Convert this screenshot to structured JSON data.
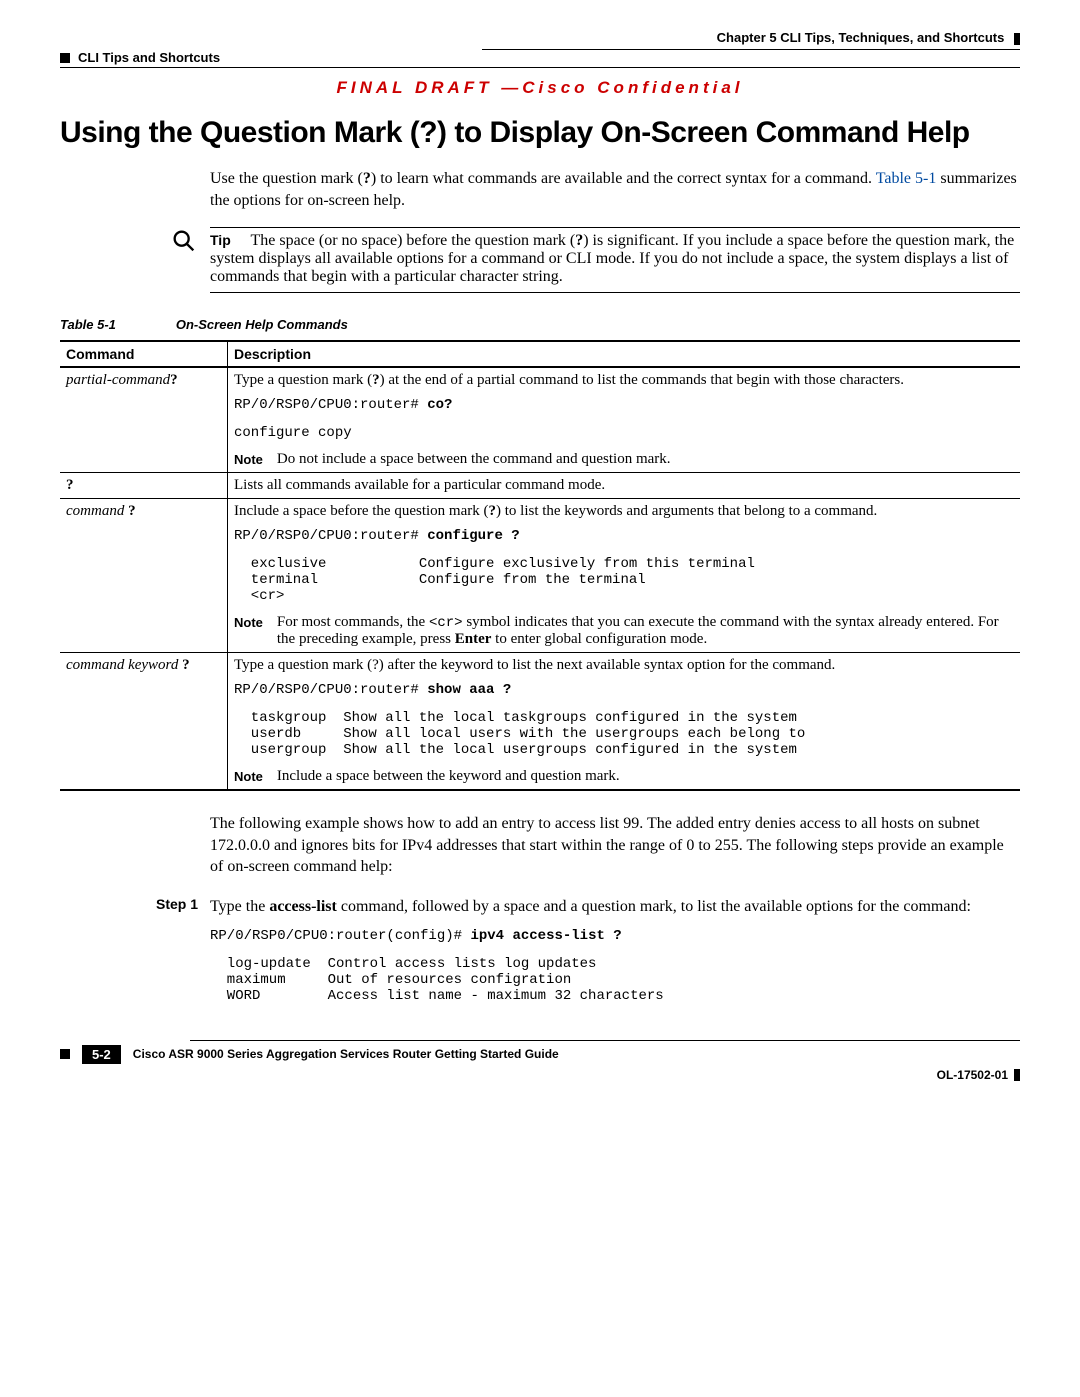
{
  "header": {
    "chapter": "Chapter 5    CLI Tips, Techniques, and Shortcuts",
    "section": "CLI Tips and Shortcuts"
  },
  "banner": "FINAL DRAFT —Cisco Confidential",
  "title": "Using the Question Mark (?) to Display On-Screen Command Help",
  "intro": {
    "line1a": "Use the question mark (",
    "line1b": ") to learn what commands are available and the correct syntax for a command. ",
    "table_ref": "Table 5-1",
    "line2": " summarizes the options for on-screen help."
  },
  "tip": {
    "label": "Tip",
    "text_a": "The space (or no space) before the question mark (",
    "text_b": ") is significant. If you include a space before the question mark, the system displays all available options for a command or CLI mode. If you do not include a space, the system displays a list of commands that begin with a particular character string."
  },
  "table": {
    "caption_num": "Table 5-1",
    "caption_title": "On-Screen Help Commands",
    "head_cmd": "Command",
    "head_desc": "Description",
    "rows": [
      {
        "cmd_html": "partial-command<span style='font-style:normal;font-weight:bold'>?</span>",
        "desc": "Type a question mark (<b>?</b>) at the end of a partial command to list the commands that begin with those characters.",
        "code_prompt": "RP/0/RSP0/CPU0:router# ",
        "code_bold": "co?",
        "code_out": "configure copy",
        "note_label": "Note",
        "note": "Do not include a space between the command and question mark."
      },
      {
        "cmd_html": "<span style='font-style:normal;font-weight:bold'>?</span>",
        "desc": "Lists all commands available for a particular command mode."
      },
      {
        "cmd_html": "command <span style='font-style:normal;font-weight:bold'>?</span>",
        "desc": "Include a space before the question mark (<b>?</b>) to list the keywords and arguments that belong to a command.",
        "code_prompt": "RP/0/RSP0/CPU0:router# ",
        "code_bold": "configure ?",
        "code_out": "  exclusive           Configure exclusively from this terminal\n  terminal            Configure from the terminal\n  <cr>",
        "note_label": "Note",
        "note": "For most commands, the <span class='mono' style='white-space:normal'>&lt;cr&gt;</span> symbol indicates that you can execute the command with the syntax already entered. For the preceding example, press <b>Enter</b> to enter global configuration mode."
      },
      {
        "cmd_html": "command keyword <span style='font-style:normal;font-weight:bold'>?</span>",
        "desc": "Type a question mark (?) after the keyword to list the next available syntax option for the command.",
        "code_prompt": "RP/0/RSP0/CPU0:router# ",
        "code_bold": "show aaa ?",
        "code_out": "  taskgroup  Show all the local taskgroups configured in the system\n  userdb     Show all local users with the usergroups each belong to\n  usergroup  Show all the local usergroups configured in the system",
        "note_label": "Note",
        "note": "Include a space between the keyword and question mark."
      }
    ]
  },
  "body_after": "The following example shows how to add an entry to access list 99. The added entry denies access to all hosts on subnet 172.0.0.0 and ignores bits for IPv4 addresses that start within the range of 0 to 255. The following steps provide an example of on-screen command help:",
  "step1": {
    "label": "Step 1",
    "text": "Type the <b>access-list</b> command, followed by a space and a question mark, to list the available options for the command:",
    "code_prompt": "RP/0/RSP0/CPU0:router(config)# ",
    "code_bold": "ipv4 access-list ?",
    "code_out": "  log-update  Control access lists log updates\n  maximum     Out of resources configration\n  WORD        Access list name - maximum 32 characters"
  },
  "footer": {
    "guide": "Cisco ASR 9000 Series Aggregation Services Router Getting Started Guide",
    "page": "5-2",
    "doc": "OL-17502-01"
  }
}
